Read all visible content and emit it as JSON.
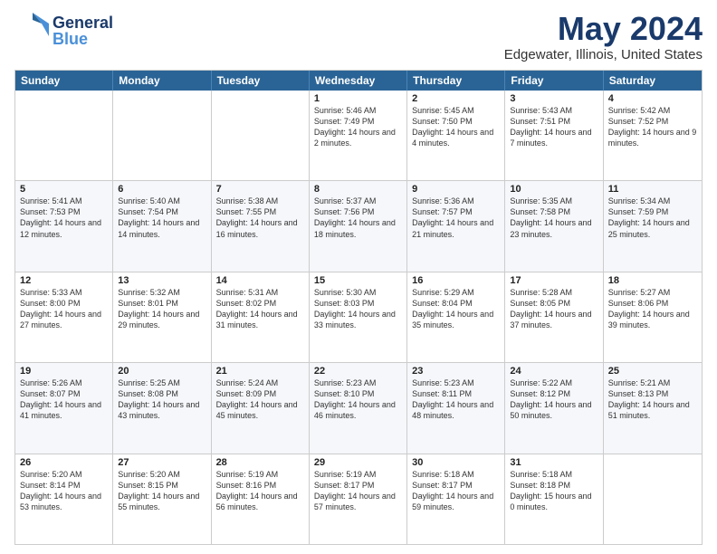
{
  "header": {
    "logo_line1": "General",
    "logo_line2": "Blue",
    "title": "May 2024",
    "subtitle": "Edgewater, Illinois, United States"
  },
  "days": [
    "Sunday",
    "Monday",
    "Tuesday",
    "Wednesday",
    "Thursday",
    "Friday",
    "Saturday"
  ],
  "weeks": [
    [
      {
        "day": "",
        "sunrise": "",
        "sunset": "",
        "daylight": ""
      },
      {
        "day": "",
        "sunrise": "",
        "sunset": "",
        "daylight": ""
      },
      {
        "day": "",
        "sunrise": "",
        "sunset": "",
        "daylight": ""
      },
      {
        "day": "1",
        "sunrise": "Sunrise: 5:46 AM",
        "sunset": "Sunset: 7:49 PM",
        "daylight": "Daylight: 14 hours and 2 minutes."
      },
      {
        "day": "2",
        "sunrise": "Sunrise: 5:45 AM",
        "sunset": "Sunset: 7:50 PM",
        "daylight": "Daylight: 14 hours and 4 minutes."
      },
      {
        "day": "3",
        "sunrise": "Sunrise: 5:43 AM",
        "sunset": "Sunset: 7:51 PM",
        "daylight": "Daylight: 14 hours and 7 minutes."
      },
      {
        "day": "4",
        "sunrise": "Sunrise: 5:42 AM",
        "sunset": "Sunset: 7:52 PM",
        "daylight": "Daylight: 14 hours and 9 minutes."
      }
    ],
    [
      {
        "day": "5",
        "sunrise": "Sunrise: 5:41 AM",
        "sunset": "Sunset: 7:53 PM",
        "daylight": "Daylight: 14 hours and 12 minutes."
      },
      {
        "day": "6",
        "sunrise": "Sunrise: 5:40 AM",
        "sunset": "Sunset: 7:54 PM",
        "daylight": "Daylight: 14 hours and 14 minutes."
      },
      {
        "day": "7",
        "sunrise": "Sunrise: 5:38 AM",
        "sunset": "Sunset: 7:55 PM",
        "daylight": "Daylight: 14 hours and 16 minutes."
      },
      {
        "day": "8",
        "sunrise": "Sunrise: 5:37 AM",
        "sunset": "Sunset: 7:56 PM",
        "daylight": "Daylight: 14 hours and 18 minutes."
      },
      {
        "day": "9",
        "sunrise": "Sunrise: 5:36 AM",
        "sunset": "Sunset: 7:57 PM",
        "daylight": "Daylight: 14 hours and 21 minutes."
      },
      {
        "day": "10",
        "sunrise": "Sunrise: 5:35 AM",
        "sunset": "Sunset: 7:58 PM",
        "daylight": "Daylight: 14 hours and 23 minutes."
      },
      {
        "day": "11",
        "sunrise": "Sunrise: 5:34 AM",
        "sunset": "Sunset: 7:59 PM",
        "daylight": "Daylight: 14 hours and 25 minutes."
      }
    ],
    [
      {
        "day": "12",
        "sunrise": "Sunrise: 5:33 AM",
        "sunset": "Sunset: 8:00 PM",
        "daylight": "Daylight: 14 hours and 27 minutes."
      },
      {
        "day": "13",
        "sunrise": "Sunrise: 5:32 AM",
        "sunset": "Sunset: 8:01 PM",
        "daylight": "Daylight: 14 hours and 29 minutes."
      },
      {
        "day": "14",
        "sunrise": "Sunrise: 5:31 AM",
        "sunset": "Sunset: 8:02 PM",
        "daylight": "Daylight: 14 hours and 31 minutes."
      },
      {
        "day": "15",
        "sunrise": "Sunrise: 5:30 AM",
        "sunset": "Sunset: 8:03 PM",
        "daylight": "Daylight: 14 hours and 33 minutes."
      },
      {
        "day": "16",
        "sunrise": "Sunrise: 5:29 AM",
        "sunset": "Sunset: 8:04 PM",
        "daylight": "Daylight: 14 hours and 35 minutes."
      },
      {
        "day": "17",
        "sunrise": "Sunrise: 5:28 AM",
        "sunset": "Sunset: 8:05 PM",
        "daylight": "Daylight: 14 hours and 37 minutes."
      },
      {
        "day": "18",
        "sunrise": "Sunrise: 5:27 AM",
        "sunset": "Sunset: 8:06 PM",
        "daylight": "Daylight: 14 hours and 39 minutes."
      }
    ],
    [
      {
        "day": "19",
        "sunrise": "Sunrise: 5:26 AM",
        "sunset": "Sunset: 8:07 PM",
        "daylight": "Daylight: 14 hours and 41 minutes."
      },
      {
        "day": "20",
        "sunrise": "Sunrise: 5:25 AM",
        "sunset": "Sunset: 8:08 PM",
        "daylight": "Daylight: 14 hours and 43 minutes."
      },
      {
        "day": "21",
        "sunrise": "Sunrise: 5:24 AM",
        "sunset": "Sunset: 8:09 PM",
        "daylight": "Daylight: 14 hours and 45 minutes."
      },
      {
        "day": "22",
        "sunrise": "Sunrise: 5:23 AM",
        "sunset": "Sunset: 8:10 PM",
        "daylight": "Daylight: 14 hours and 46 minutes."
      },
      {
        "day": "23",
        "sunrise": "Sunrise: 5:23 AM",
        "sunset": "Sunset: 8:11 PM",
        "daylight": "Daylight: 14 hours and 48 minutes."
      },
      {
        "day": "24",
        "sunrise": "Sunrise: 5:22 AM",
        "sunset": "Sunset: 8:12 PM",
        "daylight": "Daylight: 14 hours and 50 minutes."
      },
      {
        "day": "25",
        "sunrise": "Sunrise: 5:21 AM",
        "sunset": "Sunset: 8:13 PM",
        "daylight": "Daylight: 14 hours and 51 minutes."
      }
    ],
    [
      {
        "day": "26",
        "sunrise": "Sunrise: 5:20 AM",
        "sunset": "Sunset: 8:14 PM",
        "daylight": "Daylight: 14 hours and 53 minutes."
      },
      {
        "day": "27",
        "sunrise": "Sunrise: 5:20 AM",
        "sunset": "Sunset: 8:15 PM",
        "daylight": "Daylight: 14 hours and 55 minutes."
      },
      {
        "day": "28",
        "sunrise": "Sunrise: 5:19 AM",
        "sunset": "Sunset: 8:16 PM",
        "daylight": "Daylight: 14 hours and 56 minutes."
      },
      {
        "day": "29",
        "sunrise": "Sunrise: 5:19 AM",
        "sunset": "Sunset: 8:17 PM",
        "daylight": "Daylight: 14 hours and 57 minutes."
      },
      {
        "day": "30",
        "sunrise": "Sunrise: 5:18 AM",
        "sunset": "Sunset: 8:17 PM",
        "daylight": "Daylight: 14 hours and 59 minutes."
      },
      {
        "day": "31",
        "sunrise": "Sunrise: 5:18 AM",
        "sunset": "Sunset: 8:18 PM",
        "daylight": "Daylight: 15 hours and 0 minutes."
      },
      {
        "day": "",
        "sunrise": "",
        "sunset": "",
        "daylight": ""
      }
    ]
  ]
}
